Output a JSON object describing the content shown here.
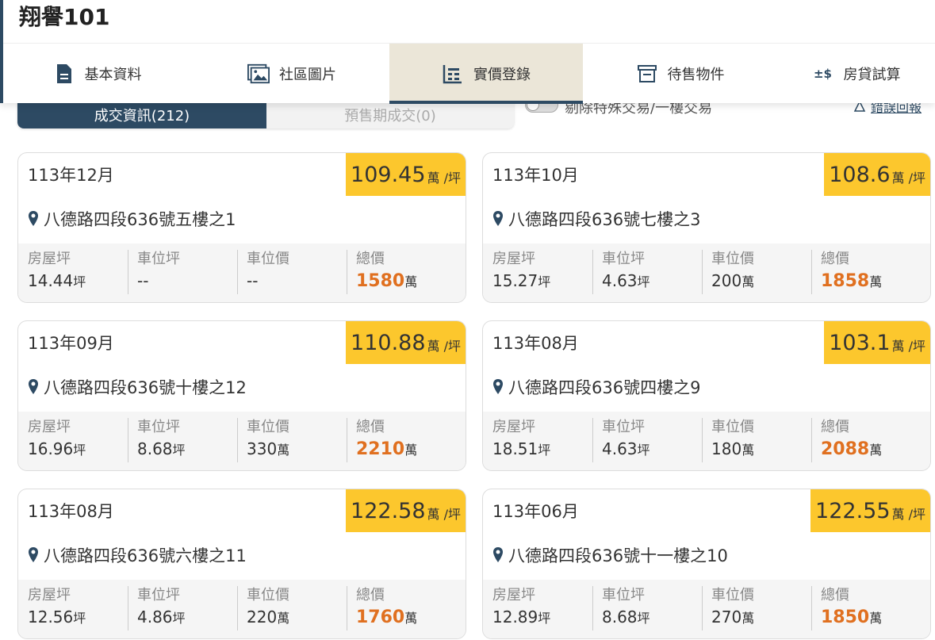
{
  "header": {
    "title": "翔譽101"
  },
  "tabs": [
    {
      "label": "基本資料",
      "icon": "document-icon"
    },
    {
      "label": "社區圖片",
      "icon": "image-gallery-icon"
    },
    {
      "label": "實價登錄",
      "icon": "price-record-icon",
      "active": true
    },
    {
      "label": "待售物件",
      "icon": "storefront-icon"
    },
    {
      "label": "房貸試算",
      "icon": "loan-calc-icon"
    }
  ],
  "tab_icon_text": {
    "loan": "±$"
  },
  "subbar": {
    "seg_a": "成交資訊(212)",
    "seg_b": "預售期成交(0)",
    "toggle_label": "剔除特殊交易/一樓交易",
    "report": "錯誤回報"
  },
  "labels": {
    "unit_area": "坪",
    "unit_money": "萬",
    "price_unit": "萬 /坪",
    "house_area": "房屋坪",
    "parking_area": "車位坪",
    "parking_price": "車位價",
    "total_price": "總價"
  },
  "colors": {
    "brand": "#2d4a63",
    "badge": "#fcc72d",
    "total": "#e07020",
    "active_tab": "#ebe6d8"
  },
  "transactions": [
    {
      "date": "113年12月",
      "price": "109.45",
      "address": "八德路四段636號五樓之1",
      "house_area": "14.44",
      "parking_area": "--",
      "parking_price": "--",
      "total": "1580"
    },
    {
      "date": "113年10月",
      "price": "108.6",
      "address": "八德路四段636號七樓之3",
      "house_area": "15.27",
      "parking_area": "4.63",
      "parking_price": "200",
      "total": "1858"
    },
    {
      "date": "113年09月",
      "price": "110.88",
      "address": "八德路四段636號十樓之12",
      "house_area": "16.96",
      "parking_area": "8.68",
      "parking_price": "330",
      "total": "2210"
    },
    {
      "date": "113年08月",
      "price": "103.1",
      "address": "八德路四段636號四樓之9",
      "house_area": "18.51",
      "parking_area": "4.63",
      "parking_price": "180",
      "total": "2088"
    },
    {
      "date": "113年08月",
      "price": "122.58",
      "address": "八德路四段636號六樓之11",
      "house_area": "12.56",
      "parking_area": "4.86",
      "parking_price": "220",
      "total": "1760"
    },
    {
      "date": "113年06月",
      "price": "122.55",
      "address": "八德路四段636號十一樓之10",
      "house_area": "12.89",
      "parking_area": "8.68",
      "parking_price": "270",
      "total": "1850"
    }
  ]
}
